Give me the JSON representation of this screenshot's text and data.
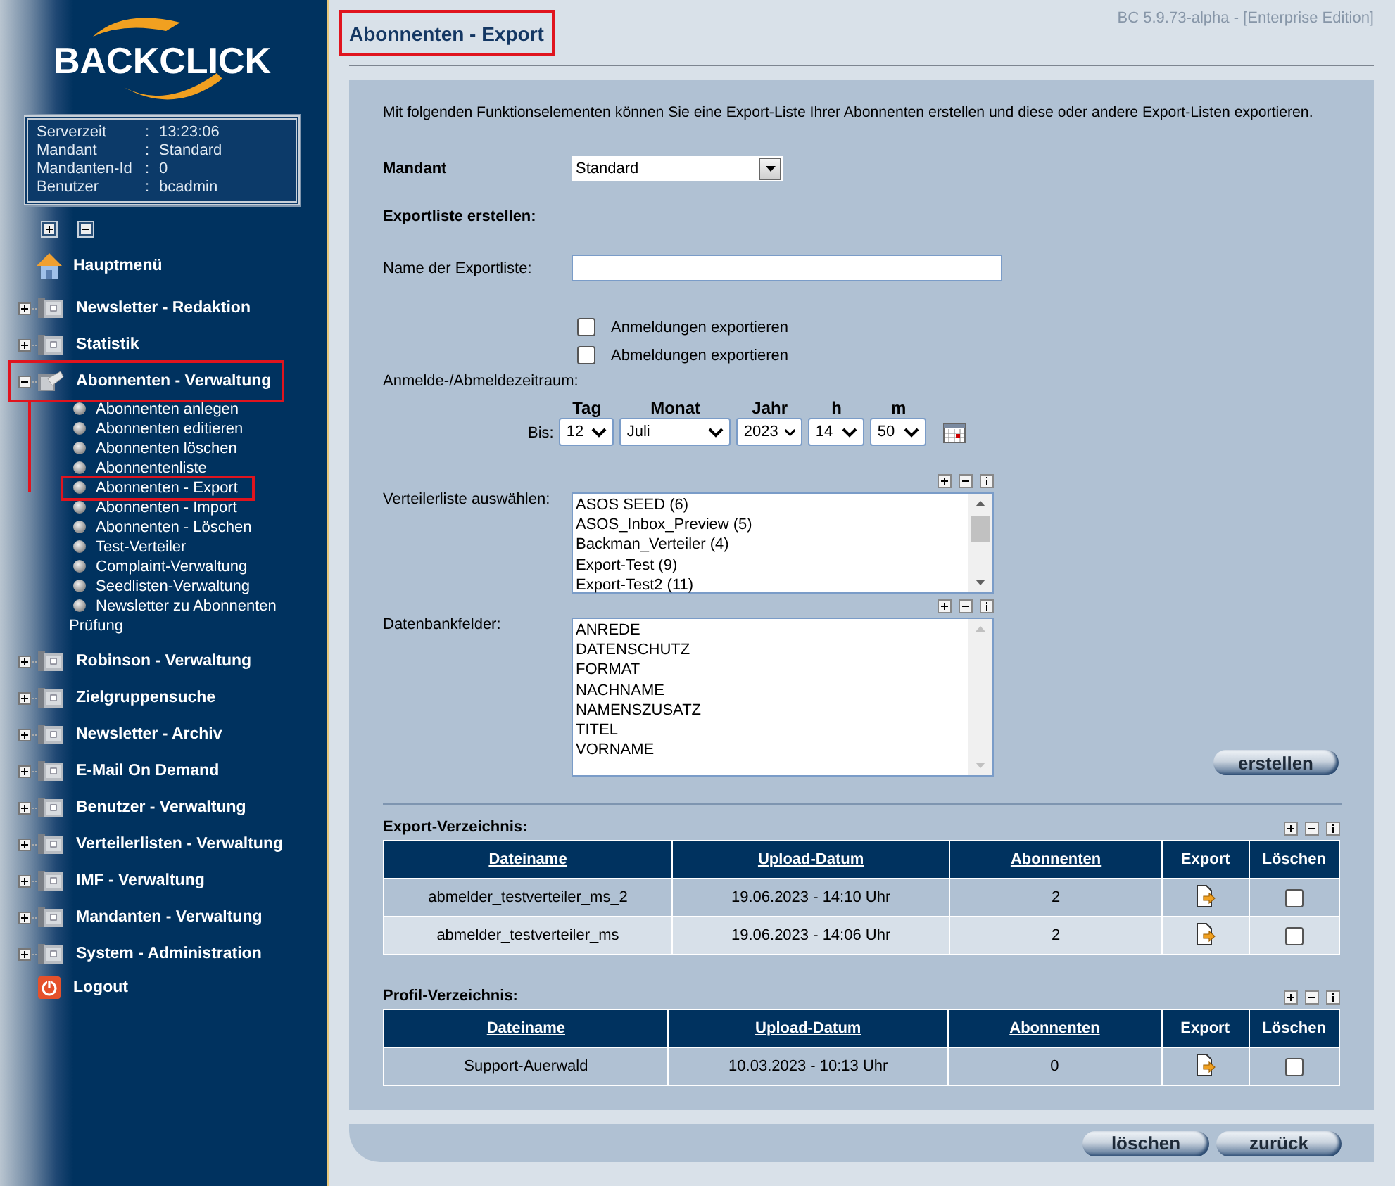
{
  "logo": {
    "text": "BACKCLICK"
  },
  "session_info": [
    {
      "label": "Serverzeit",
      "separator": ":",
      "value": "13:23:06"
    },
    {
      "label": "Mandant",
      "separator": ":",
      "value": "Standard"
    },
    {
      "label": "Mandanten-Id",
      "separator": ":",
      "value": "0"
    },
    {
      "label": "Benutzer",
      "separator": ":",
      "value": "bcadmin"
    }
  ],
  "nav": [
    {
      "kind": "home",
      "label": "Hauptmenü"
    },
    {
      "kind": "group",
      "label": "Newsletter - Redaktion",
      "expanded": false,
      "highlighted": false
    },
    {
      "kind": "group",
      "label": "Statistik",
      "expanded": false,
      "highlighted": false
    },
    {
      "kind": "group",
      "label": "Abonnenten - Verwaltung",
      "expanded": true,
      "highlighted": true,
      "children": [
        {
          "label": "Abonnenten anlegen",
          "highlighted": false
        },
        {
          "label": "Abonnenten editieren",
          "highlighted": false
        },
        {
          "label": "Abonnenten löschen",
          "highlighted": false
        },
        {
          "label": "Abonnentenliste",
          "highlighted": false
        },
        {
          "label": "Abonnenten - Export",
          "highlighted": true
        },
        {
          "label": "Abonnenten - Import",
          "highlighted": false
        },
        {
          "label": "Abonnenten - Löschen",
          "highlighted": false
        },
        {
          "label": "Test-Verteiler",
          "highlighted": false
        },
        {
          "label": "Complaint-Verwaltung",
          "highlighted": false
        },
        {
          "label": "Seedlisten-Verwaltung",
          "highlighted": false
        },
        {
          "label": "Newsletter zu Abonnenten Prüfung",
          "highlighted": false
        }
      ]
    },
    {
      "kind": "group",
      "label": "Robinson - Verwaltung",
      "expanded": false,
      "highlighted": false
    },
    {
      "kind": "group",
      "label": "Zielgruppensuche",
      "expanded": false,
      "highlighted": false
    },
    {
      "kind": "group",
      "label": "Newsletter - Archiv",
      "expanded": false,
      "highlighted": false
    },
    {
      "kind": "group",
      "label": "E-Mail On Demand",
      "expanded": false,
      "highlighted": false
    },
    {
      "kind": "group",
      "label": "Benutzer - Verwaltung",
      "expanded": false,
      "highlighted": false
    },
    {
      "kind": "group",
      "label": "Verteilerlisten - Verwaltung",
      "expanded": false,
      "highlighted": false
    },
    {
      "kind": "group",
      "label": "IMF - Verwaltung",
      "expanded": false,
      "highlighted": false
    },
    {
      "kind": "group",
      "label": "Mandanten - Verwaltung",
      "expanded": false,
      "highlighted": false
    },
    {
      "kind": "group",
      "label": "System - Administration",
      "expanded": false,
      "highlighted": false
    },
    {
      "kind": "logout",
      "label": "Logout"
    }
  ],
  "page": {
    "title": "Abonnenten - Export",
    "title_highlighted": true,
    "version": "BC 5.9.73-alpha - [Enterprise Edition]"
  },
  "intro": "Mit folgenden Funktionselementen können Sie eine Export-Liste Ihrer Abonnenten erstellen und diese oder andere Export-Listen exportieren.",
  "form": {
    "mandant": {
      "label": "Mandant",
      "value": "Standard"
    },
    "section_title": "Exportliste erstellen:",
    "name_field": {
      "label": "Name der Exportliste:"
    },
    "checkboxes": [
      {
        "label": "Anmeldungen exportieren",
        "checked": false
      },
      {
        "label": "Abmeldungen exportieren",
        "checked": false
      }
    ],
    "period": {
      "label": "Anmelde-/Abmeldezeitraum:",
      "prefix": "Bis:",
      "parts": [
        {
          "heading": "Tag",
          "value": "12"
        },
        {
          "heading": "Monat",
          "value": "Juli"
        },
        {
          "heading": "Jahr",
          "value": "2023"
        },
        {
          "heading": "h",
          "value": "14"
        },
        {
          "heading": "m",
          "value": "50"
        }
      ]
    },
    "distribution_list": {
      "label": "Verteilerliste auswählen:",
      "options": [
        {
          "label": "ASOS SEED (6)",
          "selected": false
        },
        {
          "label": "ASOS_Inbox_Preview (5)",
          "selected": false
        },
        {
          "label": "Backman_Verteiler (4)",
          "selected": false
        },
        {
          "label": "Export-Test (9)",
          "selected": false
        },
        {
          "label": "Export-Test2 (11)",
          "selected": false
        }
      ]
    },
    "db_fields": {
      "label": "Datenbankfelder:",
      "options": [
        {
          "label": "ANREDE",
          "selected": false
        },
        {
          "label": "DATENSCHUTZ",
          "selected": false
        },
        {
          "label": "FORMAT",
          "selected": false
        },
        {
          "label": "NACHNAME",
          "selected": false
        },
        {
          "label": "NAMENSZUSATZ",
          "selected": false
        },
        {
          "label": "TITEL",
          "selected": false
        },
        {
          "label": "VORNAME",
          "selected": false
        }
      ]
    },
    "create_button": "erstellen"
  },
  "directories": [
    {
      "title": "Export-Verzeichnis:",
      "columns": [
        {
          "label": "Dateiname",
          "link": true
        },
        {
          "label": "Upload-Datum",
          "link": true
        },
        {
          "label": "Abonnenten",
          "link": true
        },
        {
          "label": "Export",
          "link": false
        },
        {
          "label": "Löschen",
          "link": false
        }
      ],
      "rows": [
        {
          "cells": [
            "abmelder_testverteiler_ms_2",
            "19.06.2023 - 14:10 Uhr",
            "2"
          ],
          "delete_checked": false
        },
        {
          "cells": [
            "abmelder_testverteiler_ms",
            "19.06.2023 - 14:06 Uhr",
            "2"
          ],
          "delete_checked": false
        }
      ]
    },
    {
      "title": "Profil-Verzeichnis:",
      "columns": [
        {
          "label": "Dateiname",
          "link": true
        },
        {
          "label": "Upload-Datum",
          "link": true
        },
        {
          "label": "Abonnenten",
          "link": true
        },
        {
          "label": "Export",
          "link": false
        },
        {
          "label": "Löschen",
          "link": false
        }
      ],
      "rows": [
        {
          "cells": [
            "Support-Auerwald",
            "10.03.2023 - 10:13 Uhr",
            "0"
          ],
          "delete_checked": false
        }
      ]
    }
  ],
  "buttons": [
    "löschen",
    "zurück"
  ]
}
